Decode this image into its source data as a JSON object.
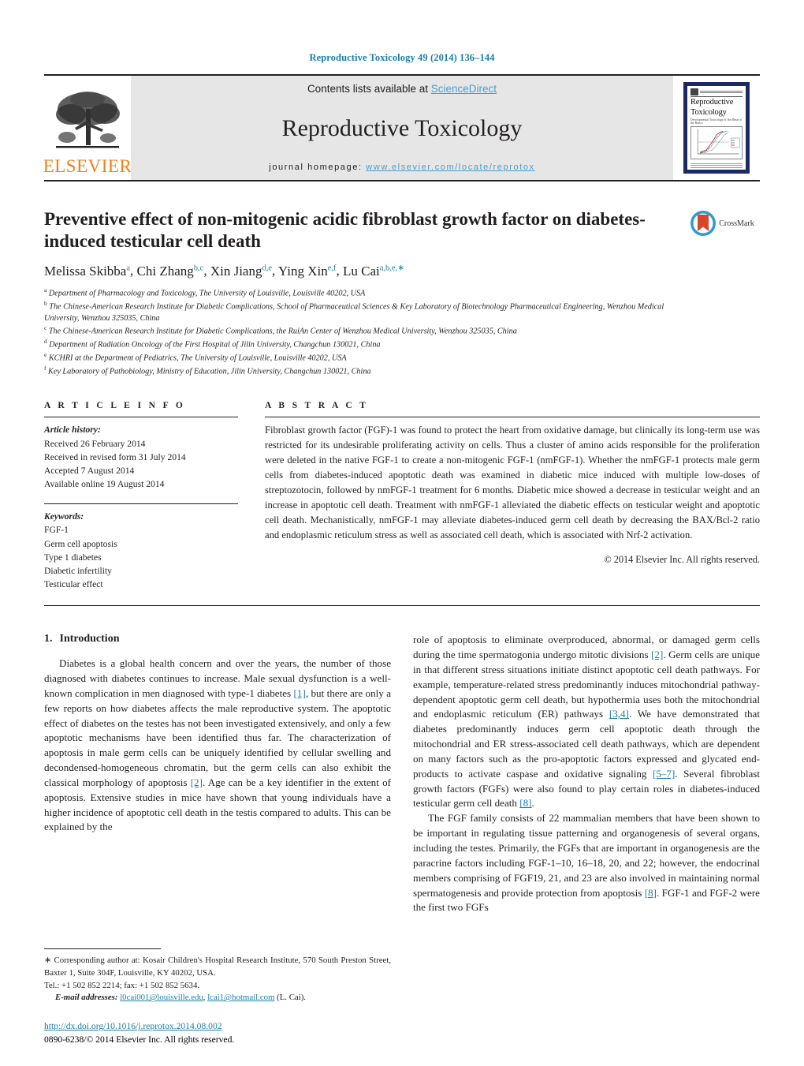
{
  "running_head": "Reproductive Toxicology 49 (2014) 136–144",
  "masthead": {
    "contents_prefix": "Contents lists available at ",
    "sciencedirect": "ScienceDirect",
    "journal_title": "Reproductive Toxicology",
    "homepage_prefix": "journal homepage: ",
    "homepage_url": "www.elsevier.com/locate/reprotox",
    "publisher_name": "ELSEVIER",
    "publisher_logo_icon": "elsevier-tree-icon",
    "cover_title_line1": "Reproductive",
    "cover_title_line2": "Toxicology",
    "cover_subtitle": "Developmental Toxicology of the Metal of the Basics",
    "accent_link_color": "#4a9ed0",
    "accent_head_color": "#1b7fa8",
    "elsevier_orange": "#f07f1a",
    "cover_border_color": "#1b2a63"
  },
  "article": {
    "title": "Preventive effect of non-mitogenic acidic fibroblast growth factor on diabetes-induced testicular cell death",
    "authors": [
      {
        "name": "Melissa Skibba",
        "sup": "a",
        "sep": ", "
      },
      {
        "name": "Chi Zhang",
        "sup": "b,c",
        "sep": ", "
      },
      {
        "name": "Xin Jiang",
        "sup": "d,e",
        "sep": ", "
      },
      {
        "name": "Ying Xin",
        "sup": "e,f",
        "sep": ", "
      },
      {
        "name": "Lu Cai",
        "sup": "a,b,e,∗",
        "sep": ""
      }
    ],
    "affiliations": [
      {
        "mark": "a",
        "text": "Department of Pharmacology and Toxicology, The University of Louisville, Louisville 40202, USA"
      },
      {
        "mark": "b",
        "text": "The Chinese-American Research Institute for Diabetic Complications, School of Pharmaceutical Sciences & Key Laboratory of Biotechnology Pharmaceutical Engineering, Wenzhou Medical University, Wenzhou 325035, China"
      },
      {
        "mark": "c",
        "text": "The Chinese-American Research Institute for Diabetic Complications, the RuiAn Center of Wenzhou Medical University, Wenzhou 325035, China"
      },
      {
        "mark": "d",
        "text": "Department of Radiation Oncology of the First Hospital of Jilin University, Changchun 130021, China"
      },
      {
        "mark": "e",
        "text": "KCHRI at the Department of Pediatrics, The University of Louisville, Louisville 40202, USA"
      },
      {
        "mark": "f",
        "text": "Key Laboratory of Pathobiology, Ministry of Education, Jilin University, Changchun 130021, China"
      }
    ],
    "crossmark_label": "CrossMark",
    "crossmark_icon": "crossmark-icon"
  },
  "article_info": {
    "heading": "A R T I C L E   I N F O",
    "history_label": "Article history:",
    "history": [
      "Received 26 February 2014",
      "Received in revised form 31 July 2014",
      "Accepted 7 August 2014",
      "Available online 19 August 2014"
    ],
    "keywords_label": "Keywords:",
    "keywords": [
      "FGF-1",
      "Germ cell apoptosis",
      "Type 1 diabetes",
      "Diabetic infertility",
      "Testicular effect"
    ]
  },
  "abstract": {
    "heading": "A B S T R A C T",
    "text": "Fibroblast growth factor (FGF)-1 was found to protect the heart from oxidative damage, but clinically its long-term use was restricted for its undesirable proliferating activity on cells. Thus a cluster of amino acids responsible for the proliferation were deleted in the native FGF-1 to create a non-mitogenic FGF-1 (nmFGF-1). Whether the nmFGF-1 protects male germ cells from diabetes-induced apoptotic death was examined in diabetic mice induced with multiple low-doses of streptozotocin, followed by nmFGF-1 treatment for 6 months. Diabetic mice showed a decrease in testicular weight and an increase in apoptotic cell death. Treatment with nmFGF-1 alleviated the diabetic effects on testicular weight and apoptotic cell death. Mechanistically, nmFGF-1 may alleviate diabetes-induced germ cell death by decreasing the BAX/Bcl-2 ratio and endoplasmic reticulum stress as well as associated cell death, which is associated with Nrf-2 activation.",
    "copyright": "© 2014 Elsevier Inc. All rights reserved."
  },
  "introduction": {
    "number": "1.",
    "heading": "Introduction",
    "left_paragraph_1_a": "Diabetes is a global health concern and over the years, the number of those diagnosed with diabetes continues to increase. Male sexual dysfunction is a well-known complication in men diagnosed with type-1 diabetes ",
    "left_ref_1": "[1]",
    "left_paragraph_1_b": ", but there are only a few reports on how diabetes affects the male reproductive system. The apoptotic effect of diabetes on the testes has not been investigated extensively, and only a few apoptotic mechanisms have been identified thus far. The characterization of apoptosis in male germ cells can be uniquely identified by cellular swelling and decondensed-homogeneous chromatin, but the germ cells can also exhibit the classical morphology of apoptosis ",
    "left_ref_2": "[2]",
    "left_paragraph_1_c": ". Age can be a key identifier in the extent of apoptosis. Extensive studies in mice have shown that young individuals have a higher incidence of apoptotic cell death in the testis compared to adults. This can be explained by the",
    "right_paragraph_1_a": "role of apoptosis to eliminate overproduced, abnormal, or damaged germ cells during the time spermatogonia undergo mitotic divisions ",
    "right_ref_1": "[2]",
    "right_paragraph_1_b": ". Germ cells are unique in that different stress situations initiate distinct apoptotic cell death pathways. For example, temperature-related stress predominantly induces mitochondrial pathway-dependent apoptotic germ cell death, but hypothermia uses both the mitochondrial and endoplasmic reticulum (ER) pathways ",
    "right_ref_2": "[3,4]",
    "right_paragraph_1_c": ". We have demonstrated that diabetes predominantly induces germ cell apoptotic death through the mitochondrial and ER stress-associated cell death pathways, which are dependent on many factors such as the pro-apoptotic factors expressed and glycated end-products to activate caspase and oxidative signaling ",
    "right_ref_3": "[5–7]",
    "right_paragraph_1_d": ". Several fibroblast growth factors (FGFs) were also found to play certain roles in diabetes-induced testicular germ cell death ",
    "right_ref_4": "[8]",
    "right_paragraph_1_e": ".",
    "right_paragraph_2_a": "The FGF family consists of 22 mammalian members that have been shown to be important in regulating tissue patterning and organogenesis of several organs, including the testes. Primarily, the FGFs that are important in organogenesis are the paracrine factors including FGF-1–10, 16–18, 20, and 22; however, the endocrinal members comprising of FGF19, 21, and 23 are also involved in maintaining normal spermatogenesis and provide protection from apoptosis ",
    "right_ref_5": "[8]",
    "right_paragraph_2_b": ". FGF-1 and FGF-2 were the first two FGFs"
  },
  "footnote": {
    "star": "∗",
    "corresponding_text": " Corresponding author at: Kosair Children's Hospital Research Institute, 570 South Preston Street, Baxter 1, Suite 304F, Louisville, KY 40202, USA.",
    "tel": "Tel.: +1 502 852 2214; fax: +1 502 852 5634.",
    "email_label": "E-mail addresses:",
    "email_1": "l0cai001@louisville.edu",
    "email_sep": ", ",
    "email_2": "lcai1@hotmail.com",
    "email_suffix": " (L. Cai).",
    "doi": "http://dx.doi.org/10.1016/j.reprotox.2014.08.002",
    "issn_line": "0890-6238/© 2014 Elsevier Inc. All rights reserved."
  }
}
